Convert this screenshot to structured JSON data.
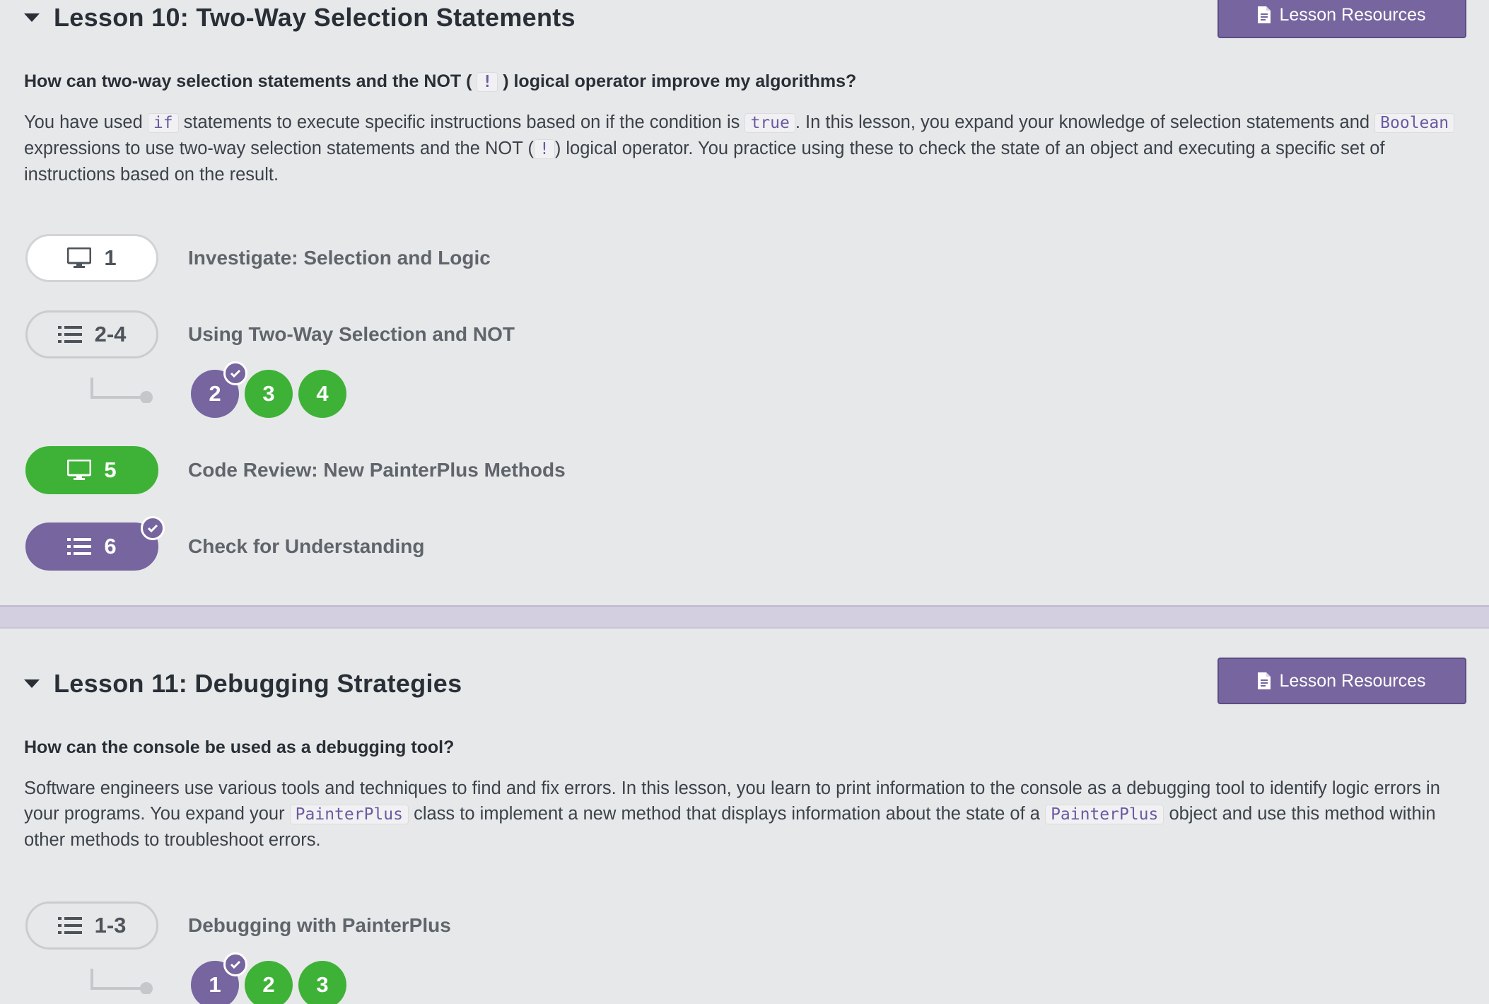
{
  "lesson10": {
    "title": "Lesson 10: Two-Way Selection Statements",
    "resources_label": "Lesson Resources",
    "question": {
      "part1": "How can two-way selection statements and the NOT (",
      "operator": "!",
      "part2": ") logical operator improve my algorithms?"
    },
    "description": {
      "t1": "You have used ",
      "c1": "if",
      "t2": " statements to execute specific instructions based on if the condition is ",
      "c2": "true",
      "t3": ". In this lesson, you expand your knowledge of selection statements and ",
      "c3": "Boolean",
      "t4": " expressions to use two-way selection statements and the NOT (",
      "c4": "!",
      "t5": ") logical operator. You practice using these to check the state of an object and executing a specific set of instructions based on the result."
    },
    "steps": [
      {
        "number": "1",
        "label": "Investigate: Selection and Logic",
        "icon": "monitor-icon",
        "style": "white"
      },
      {
        "number": "2-4",
        "label": "Using Two-Way Selection and NOT",
        "icon": "list-icon",
        "style": "outline"
      },
      {
        "number": "5",
        "label": "Code Review: New PainterPlus Methods",
        "icon": "monitor-icon",
        "style": "green"
      },
      {
        "number": "6",
        "label": "Check for Understanding",
        "icon": "list-icon",
        "style": "purple",
        "completed": true
      }
    ],
    "sub_levels": [
      {
        "number": "2",
        "status": "completed"
      },
      {
        "number": "3",
        "status": "attempted"
      },
      {
        "number": "4",
        "status": "attempted"
      }
    ]
  },
  "lesson11": {
    "title": "Lesson 11: Debugging Strategies",
    "resources_label": "Lesson Resources",
    "question": "How can the console be used as a debugging tool?",
    "description": {
      "t1": "Software engineers use various tools and techniques to find and fix errors. In this lesson, you learn to print information to the console as a debugging tool to identify logic errors in your programs. You expand your ",
      "c1": "PainterPlus",
      "t2": " class to implement a new method that displays information about the state of a ",
      "c2": "PainterPlus",
      "t3": " object and use this method within other methods to troubleshoot errors."
    },
    "steps": [
      {
        "number": "1-3",
        "label": "Debugging with PainterPlus",
        "icon": "list-icon",
        "style": "outline"
      }
    ],
    "sub_levels": [
      {
        "number": "1",
        "status": "completed"
      },
      {
        "number": "2",
        "status": "attempted"
      },
      {
        "number": "3",
        "status": "attempted"
      }
    ]
  },
  "colors": {
    "background": "#e7e8ea",
    "purple": "#76659e",
    "green": "#3eb236",
    "divider": "#d4cfe0"
  }
}
